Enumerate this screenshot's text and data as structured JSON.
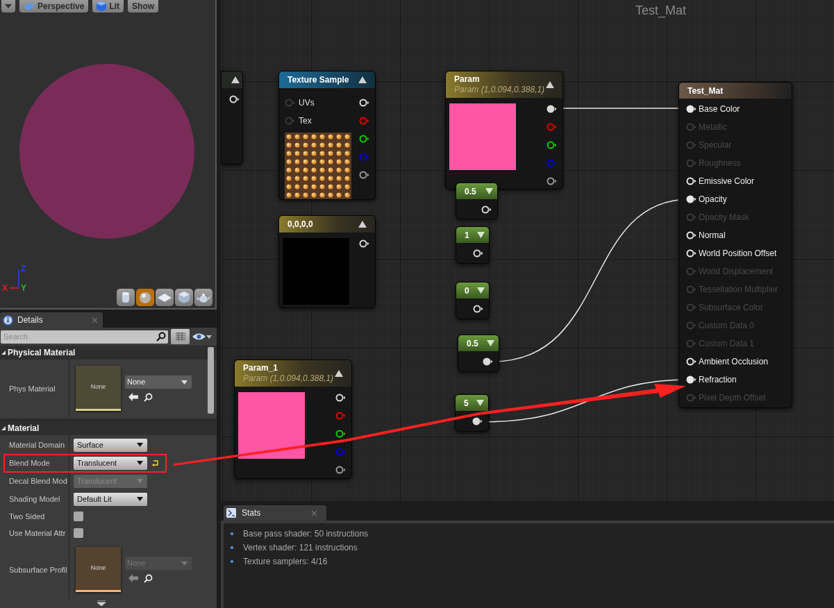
{
  "viewport": {
    "menu_button": {
      "kind": "menu"
    },
    "toolbar": [
      {
        "label": "Perspective",
        "kind": "perspective"
      },
      {
        "label": "Lit",
        "kind": "lit"
      },
      {
        "label": "Show",
        "kind": "plain"
      }
    ],
    "axes": [
      {
        "label": "Z",
        "color": "#2040ff"
      },
      {
        "label": "X",
        "color": "#e02020"
      },
      {
        "label": "Y",
        "color": "#20c020"
      }
    ],
    "preview_shapes": [
      {
        "kind": "cylinder",
        "selected": false
      },
      {
        "kind": "sphere",
        "selected": true
      },
      {
        "kind": "plane",
        "selected": false
      },
      {
        "kind": "cube",
        "selected": false
      },
      {
        "kind": "teapot",
        "selected": false
      }
    ]
  },
  "details": {
    "tab": "Details",
    "search": {
      "placeholder": "Search"
    },
    "sections": [
      {
        "title": "Physical Material",
        "expanded": true,
        "rows": [
          {
            "kind": "asset",
            "label": "Phys Material",
            "thumbnail": "None",
            "value": "None",
            "color": "#d8cf8a",
            "disabled": false
          }
        ]
      },
      {
        "title": "Material",
        "expanded": true,
        "rows": [
          {
            "kind": "dropdown",
            "label": "Material Domain",
            "value": "Surface",
            "disabled": false,
            "modified": false
          },
          {
            "kind": "dropdown",
            "label": "Blend Mode",
            "value": "Translucent",
            "disabled": false,
            "modified": true
          },
          {
            "kind": "dropdown",
            "label": "Decal Blend Mod",
            "value": "Translucent",
            "disabled": true,
            "modified": false
          },
          {
            "kind": "dropdown",
            "label": "Shading Model",
            "value": "Default Lit",
            "disabled": false,
            "modified": false
          },
          {
            "kind": "checkbox",
            "label": "Two Sided",
            "checked": false
          },
          {
            "kind": "checkbox",
            "label": "Use Material Attr",
            "checked": false
          },
          {
            "kind": "asset",
            "label": "Subsurface Profil",
            "thumbnail": "None",
            "value": "None",
            "color": "#ffb070",
            "disabled": true
          }
        ]
      }
    ]
  },
  "graph": {
    "title": "Test_Mat",
    "nodes": [
      {
        "kind": "stub"
      },
      {
        "kind": "texture",
        "title": "Texture Sample",
        "inputs": [
          "UVs",
          "Tex"
        ],
        "outputs": [
          {
            "color": "#d8d8d8",
            "connected": false
          },
          {
            "color": "#e00000",
            "connected": false
          },
          {
            "color": "#00d000",
            "connected": false
          },
          {
            "color": "#0000e0",
            "connected": false
          },
          {
            "color": "#9a9a9a",
            "connected": false
          }
        ]
      },
      {
        "kind": "constant",
        "title": "0,0,0,0",
        "outputs": [
          {
            "color": "#d8d8d8",
            "connected": false
          }
        ]
      },
      {
        "kind": "param",
        "title": "Param",
        "subtitle": "Param (1,0.094,0.388,1)",
        "outputs": [
          {
            "color": "#d8d8d8",
            "connected": true
          },
          {
            "color": "#e00000",
            "connected": false
          },
          {
            "color": "#00d000",
            "connected": false
          },
          {
            "color": "#0000e0",
            "connected": false
          },
          {
            "color": "#9a9a9a",
            "connected": false
          }
        ]
      },
      {
        "kind": "scalar",
        "title": "0.5",
        "outputs": [
          {
            "color": "#d8d8d8",
            "connected": false
          }
        ]
      },
      {
        "kind": "scalar",
        "title": "1",
        "outputs": [
          {
            "color": "#d8d8d8",
            "connected": false
          }
        ]
      },
      {
        "kind": "scalar",
        "title": "0",
        "outputs": [
          {
            "color": "#d8d8d8",
            "connected": false
          }
        ]
      },
      {
        "kind": "scalar",
        "title": "0.5",
        "outputs": [
          {
            "color": "#d8d8d8",
            "connected": true
          }
        ]
      },
      {
        "kind": "scalar",
        "title": "5",
        "outputs": [
          {
            "color": "#d8d8d8",
            "connected": true
          }
        ]
      },
      {
        "kind": "param",
        "title": "Param_1",
        "subtitle": "Param (1,0.094,0.388,1)",
        "outputs": [
          {
            "color": "#d8d8d8",
            "connected": false
          },
          {
            "color": "#e00000",
            "connected": false
          },
          {
            "color": "#00d000",
            "connected": false
          },
          {
            "color": "#0000e0",
            "connected": false
          },
          {
            "color": "#9a9a9a",
            "connected": false
          }
        ]
      },
      {
        "kind": "material",
        "title": "Test_Mat",
        "inputs": [
          {
            "label": "Base Color",
            "enabled": true,
            "connected": true
          },
          {
            "label": "Metallic",
            "enabled": false,
            "connected": false
          },
          {
            "label": "Specular",
            "enabled": false,
            "connected": false
          },
          {
            "label": "Roughness",
            "enabled": false,
            "connected": false
          },
          {
            "label": "Emissive Color",
            "enabled": true,
            "connected": false
          },
          {
            "label": "Opacity",
            "enabled": true,
            "connected": true
          },
          {
            "label": "Opacity Mask",
            "enabled": false,
            "connected": false
          },
          {
            "label": "Normal",
            "enabled": true,
            "connected": false
          },
          {
            "label": "World Position Offset",
            "enabled": true,
            "connected": false
          },
          {
            "label": "World Displacement",
            "enabled": false,
            "connected": false
          },
          {
            "label": "Tessellation Multiplier",
            "enabled": false,
            "connected": false
          },
          {
            "label": "Subsurface Color",
            "enabled": false,
            "connected": false
          },
          {
            "label": "Custom Data 0",
            "enabled": false,
            "connected": false
          },
          {
            "label": "Custom Data 1",
            "enabled": false,
            "connected": false
          },
          {
            "label": "Ambient Occlusion",
            "enabled": true,
            "connected": false
          },
          {
            "label": "Refraction",
            "enabled": true,
            "connected": true
          },
          {
            "label": "Pixel Depth Offset",
            "enabled": false,
            "connected": false
          }
        ]
      }
    ]
  },
  "stats": {
    "tab": "Stats",
    "lines": [
      "Base pass shader: 50 instructions",
      "Vertex shader: 121 instructions",
      "Texture samplers: 4/16"
    ]
  }
}
